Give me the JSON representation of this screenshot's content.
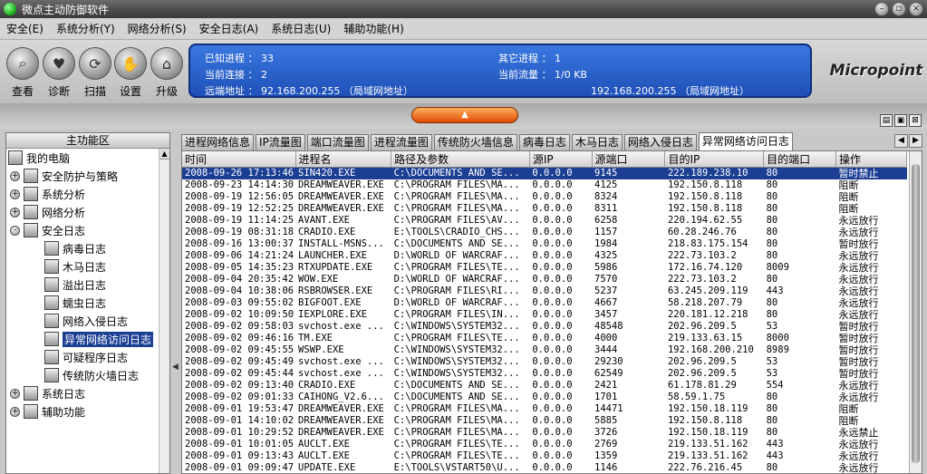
{
  "window": {
    "title": "微点主动防御软件",
    "controls": [
      "minimize",
      "restore",
      "close"
    ]
  },
  "menu": [
    "安全(E)",
    "系统分析(Y)",
    "网络分析(S)",
    "安全日志(A)",
    "系统日志(U)",
    "辅助功能(H)"
  ],
  "toolbar": [
    {
      "label": "查看",
      "icon": "magnifier-icon"
    },
    {
      "label": "诊断",
      "icon": "heart-icon"
    },
    {
      "label": "扫描",
      "icon": "scan-icon"
    },
    {
      "label": "设置",
      "icon": "hand-icon"
    },
    {
      "label": "升级",
      "icon": "house-icon"
    }
  ],
  "info": {
    "known_proc_label": "已知进程 ： 33",
    "other_proc_label": "其它进程 ： 1",
    "conn_label": "当前连接 ： 2",
    "flow_label": "当前流量 ： 1/0 KB",
    "remote_label": "远端地址 ：  92.168.200.255 （局域网地址）",
    "local_label": "192.168.200.255 （局域网地址）"
  },
  "brand": "Micropoint",
  "left_panel": {
    "header": "主功能区",
    "tree": [
      {
        "label": "我的电脑",
        "level": 0,
        "expander": ""
      },
      {
        "label": "安全防护与策略",
        "level": 1,
        "expander": "+"
      },
      {
        "label": "系统分析",
        "level": 1,
        "expander": "+"
      },
      {
        "label": "网络分析",
        "level": 1,
        "expander": "+"
      },
      {
        "label": "安全日志",
        "level": 1,
        "expander": "-"
      },
      {
        "label": "病毒日志",
        "level": 2,
        "expander": ""
      },
      {
        "label": "木马日志",
        "level": 2,
        "expander": ""
      },
      {
        "label": "溢出日志",
        "level": 2,
        "expander": ""
      },
      {
        "label": "蠕虫日志",
        "level": 2,
        "expander": ""
      },
      {
        "label": "网络入侵日志",
        "level": 2,
        "expander": ""
      },
      {
        "label": "异常网络访问日志",
        "level": 2,
        "expander": "",
        "selected": true
      },
      {
        "label": "可疑程序日志",
        "level": 2,
        "expander": ""
      },
      {
        "label": "传统防火墙日志",
        "level": 2,
        "expander": ""
      },
      {
        "label": "系统日志",
        "level": 1,
        "expander": "+"
      },
      {
        "label": "辅助功能",
        "level": 1,
        "expander": "+"
      }
    ]
  },
  "tabs": [
    "进程网络信息",
    "IP流量图",
    "端口流量图",
    "进程流量图",
    "传统防火墙信息",
    "病毒日志",
    "木马日志",
    "网络入侵日志",
    "异常网络访问日志"
  ],
  "active_tab": 8,
  "table": {
    "columns": [
      "时间",
      "进程名",
      "路径及参数",
      "源IP",
      "源端口",
      "目的IP",
      "目的端口",
      "操作"
    ],
    "rows": [
      [
        "2008-09-26 17:13:46",
        "SIN420.EXE",
        "C:\\DOCUMENTS AND SE...",
        "0.0.0.0",
        "9145",
        "222.189.238.10",
        "80",
        "暂时禁止"
      ],
      [
        "2008-09-23 14:14:30",
        "DREAMWEAVER.EXE",
        "C:\\PROGRAM FILES\\MA...",
        "0.0.0.0",
        "4125",
        "192.150.8.118",
        "80",
        "阻断"
      ],
      [
        "2008-09-19 12:56:05",
        "DREAMWEAVER.EXE",
        "C:\\PROGRAM FILES\\MA...",
        "0.0.0.0",
        "8324",
        "192.150.8.118",
        "80",
        "阻断"
      ],
      [
        "2008-09-19 12:52:25",
        "DREAMWEAVER.EXE",
        "C:\\PROGRAM FILES\\MA...",
        "0.0.0.0",
        "8311",
        "192.150.8.118",
        "80",
        "阻断"
      ],
      [
        "2008-09-19 11:14:25",
        "AVANT.EXE",
        "C:\\PROGRAM FILES\\AV...",
        "0.0.0.0",
        "6258",
        "220.194.62.55",
        "80",
        "永远放行"
      ],
      [
        "2008-09-19 08:31:18",
        "CRADIO.EXE",
        "E:\\TOOLS\\CRADIO_CHS...",
        "0.0.0.0",
        "1157",
        "60.28.246.76",
        "80",
        "永远放行"
      ],
      [
        "2008-09-16 13:00:37",
        "INSTALL-MSNS...",
        "C:\\DOCUMENTS AND SE...",
        "0.0.0.0",
        "1984",
        "218.83.175.154",
        "80",
        "暂时放行"
      ],
      [
        "2008-09-06 14:21:24",
        "LAUNCHER.EXE",
        "D:\\WORLD OF WARCRAF...",
        "0.0.0.0",
        "4325",
        "222.73.103.2",
        "80",
        "永远放行"
      ],
      [
        "2008-09-05 14:35:23",
        "RTXUPDATE.EXE",
        "C:\\PROGRAM FILES\\TE...",
        "0.0.0.0",
        "5986",
        "172.16.74.120",
        "8009",
        "永远放行"
      ],
      [
        "2008-09-04 20:35:42",
        "WOW.EXE",
        "D:\\WORLD OF WARCRAF...",
        "0.0.0.0",
        "7570",
        "222.73.103.2",
        "80",
        "永远放行"
      ],
      [
        "2008-09-04 10:38:06",
        "RSBROWSER.EXE",
        "C:\\PROGRAM FILES\\RI...",
        "0.0.0.0",
        "5237",
        "63.245.209.119",
        "443",
        "永远放行"
      ],
      [
        "2008-09-03 09:55:02",
        "BIGFOOT.EXE",
        "D:\\WORLD OF WARCRAF...",
        "0.0.0.0",
        "4667",
        "58.218.207.79",
        "80",
        "永远放行"
      ],
      [
        "2008-09-02 10:09:50",
        "IEXPLORE.EXE",
        "C:\\PROGRAM FILES\\IN...",
        "0.0.0.0",
        "3457",
        "220.181.12.218",
        "80",
        "永远放行"
      ],
      [
        "2008-09-02 09:58:03",
        "svchost.exe ...",
        "C:\\WINDOWS\\SYSTEM32...",
        "0.0.0.0",
        "48548",
        "202.96.209.5",
        "53",
        "暂时放行"
      ],
      [
        "2008-09-02 09:46:16",
        "TM.EXE",
        "C:\\PROGRAM FILES\\TE...",
        "0.0.0.0",
        "4000",
        "219.133.63.15",
        "8000",
        "暂时放行"
      ],
      [
        "2008-09-02 09:45:55",
        "WSWP.EXE",
        "C:\\WINDOWS\\SYSTEM32...",
        "0.0.0.0",
        "3444",
        "192.168.200.210",
        "8989",
        "暂时放行"
      ],
      [
        "2008-09-02 09:45:49",
        "svchost.exe ...",
        "C:\\WINDOWS\\SYSTEM32...",
        "0.0.0.0",
        "29230",
        "202.96.209.5",
        "53",
        "暂时放行"
      ],
      [
        "2008-09-02 09:45:44",
        "svchost.exe ...",
        "C:\\WINDOWS\\SYSTEM32...",
        "0.0.0.0",
        "62549",
        "202.96.209.5",
        "53",
        "暂时放行"
      ],
      [
        "2008-09-02 09:13:40",
        "CRADIO.EXE",
        "C:\\DOCUMENTS AND SE...",
        "0.0.0.0",
        "2421",
        "61.178.81.29",
        "554",
        "永远放行"
      ],
      [
        "2008-09-02 09:01:33",
        "CAIHONG_V2.6...",
        "C:\\DOCUMENTS AND SE...",
        "0.0.0.0",
        "1701",
        "58.59.1.75",
        "80",
        "永远放行"
      ],
      [
        "2008-09-01 19:53:47",
        "DREAMWEAVER.EXE",
        "C:\\PROGRAM FILES\\MA...",
        "0.0.0.0",
        "14471",
        "192.150.18.119",
        "80",
        "阻断"
      ],
      [
        "2008-09-01 14:10:02",
        "DREAMWEAVER.EXE",
        "C:\\PROGRAM FILES\\MA...",
        "0.0.0.0",
        "5885",
        "192.150.8.118",
        "80",
        "阻断"
      ],
      [
        "2008-09-01 10:29:52",
        "DREAMWEAVER.EXE",
        "C:\\PROGRAM FILES\\MA...",
        "0.0.0.0",
        "3726",
        "192.150.18.119",
        "80",
        "永远禁止"
      ],
      [
        "2008-09-01 10:01:05",
        "AUCLT.EXE",
        "C:\\PROGRAM FILES\\TE...",
        "0.0.0.0",
        "2769",
        "219.133.51.162",
        "443",
        "永远放行"
      ],
      [
        "2008-09-01 09:13:43",
        "AUCLT.EXE",
        "C:\\PROGRAM FILES\\TE...",
        "0.0.0.0",
        "1359",
        "219.133.51.162",
        "443",
        "永远放行"
      ],
      [
        "2008-09-01 09:09:47",
        "UPDATE.EXE",
        "E:\\TOOLS\\VSTART50\\U...",
        "0.0.0.0",
        "1146",
        "222.76.216.45",
        "80",
        "永远放行"
      ]
    ],
    "selected_row": 0
  }
}
